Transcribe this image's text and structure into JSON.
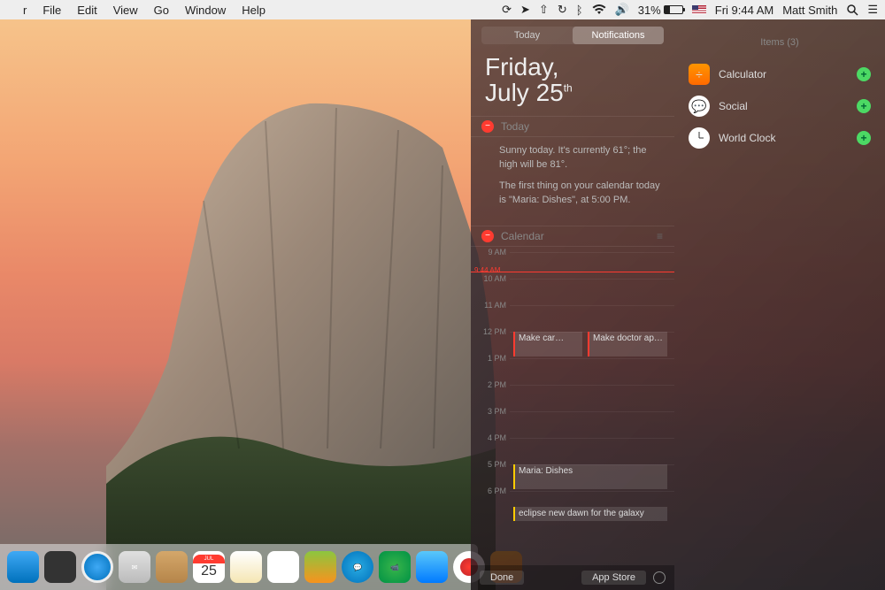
{
  "menubar": {
    "app_menus": [
      "r",
      "File",
      "Edit",
      "View",
      "Go",
      "Window",
      "Help"
    ],
    "battery_pct": "31%",
    "clock": "Fri 9:44 AM",
    "user": "Matt Smith"
  },
  "dock": {
    "cal_month": "JUL",
    "cal_day": "25"
  },
  "nc": {
    "tabs": {
      "today": "Today",
      "notifications": "Notifications"
    },
    "date": {
      "weekday": "Friday,",
      "month_day": "July 25",
      "suffix": "th"
    },
    "today_widget": {
      "title": "Today",
      "weather": "Sunny today. It's currently 61°; the high will be 81°.",
      "summary": "The first thing on your calendar today is \"Maria: Dishes\", at 5:00 PM."
    },
    "calendar_widget": {
      "title": "Calendar",
      "now_label": "9:44 AM",
      "hours": [
        "9 AM",
        "10 AM",
        "11 AM",
        "12 PM",
        "1 PM",
        "2 PM",
        "3 PM",
        "4 PM",
        "5 PM",
        "6 PM"
      ],
      "events": {
        "e1": "Make car…",
        "e2": "Make doctor ap…",
        "e3": "Maria: Dishes",
        "e4": "eclipse new dawn for the galaxy"
      }
    },
    "footer": {
      "done": "Done",
      "appstore": "App Store"
    },
    "items": {
      "header": "Items (3)",
      "list": [
        {
          "label": "Calculator"
        },
        {
          "label": "Social"
        },
        {
          "label": "World Clock"
        }
      ]
    }
  }
}
